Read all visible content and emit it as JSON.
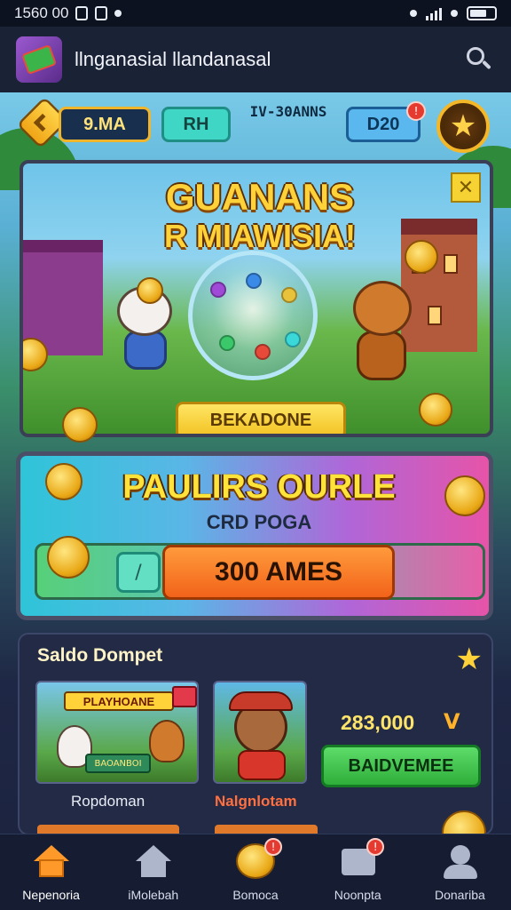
{
  "status_bar": {
    "time": "1560 00"
  },
  "app_bar": {
    "title": "llnganasial llandanasal"
  },
  "hud": {
    "left_pill": "9.MA",
    "mid_pill": "RH",
    "caption_small": "",
    "caption_big": "IV-30ANNS",
    "right_pill": "D20",
    "badge": "!"
  },
  "banner_main": {
    "title_line1": "GUANANS",
    "title_line2": "R MIAWISIA!",
    "button": "BEKADONE"
  },
  "banner_promo": {
    "title": "PAULIRS OURLE",
    "subtitle": "CRD POGA",
    "button": "300 AMES",
    "ticket": "/"
  },
  "wallet": {
    "title": "Saldo Dompet",
    "game1_logo": "PLAYHOANE",
    "game1_plate": "BAOANBOI",
    "game1_label": "Ropdoman",
    "game2_label": "Nalgnlotam",
    "amount": "283,000",
    "amount_suffix": "V",
    "button": "BAIDVEMEE"
  },
  "bottom_nav": [
    {
      "label": "Nepenoria",
      "icon": "home-icon"
    },
    {
      "label": "iMolebah",
      "icon": "house-icon"
    },
    {
      "label": "Bomoca",
      "icon": "coin-icon",
      "badge": "!"
    },
    {
      "label": "Noonpta",
      "icon": "folder-icon",
      "badge": "!"
    },
    {
      "label": "Donariba",
      "icon": "user-icon"
    }
  ],
  "colors": {
    "accent_gold": "#ffd23a",
    "accent_orange": "#ff9a2a",
    "nav_bg": "#161d33",
    "panel_bg": "#222a45"
  }
}
